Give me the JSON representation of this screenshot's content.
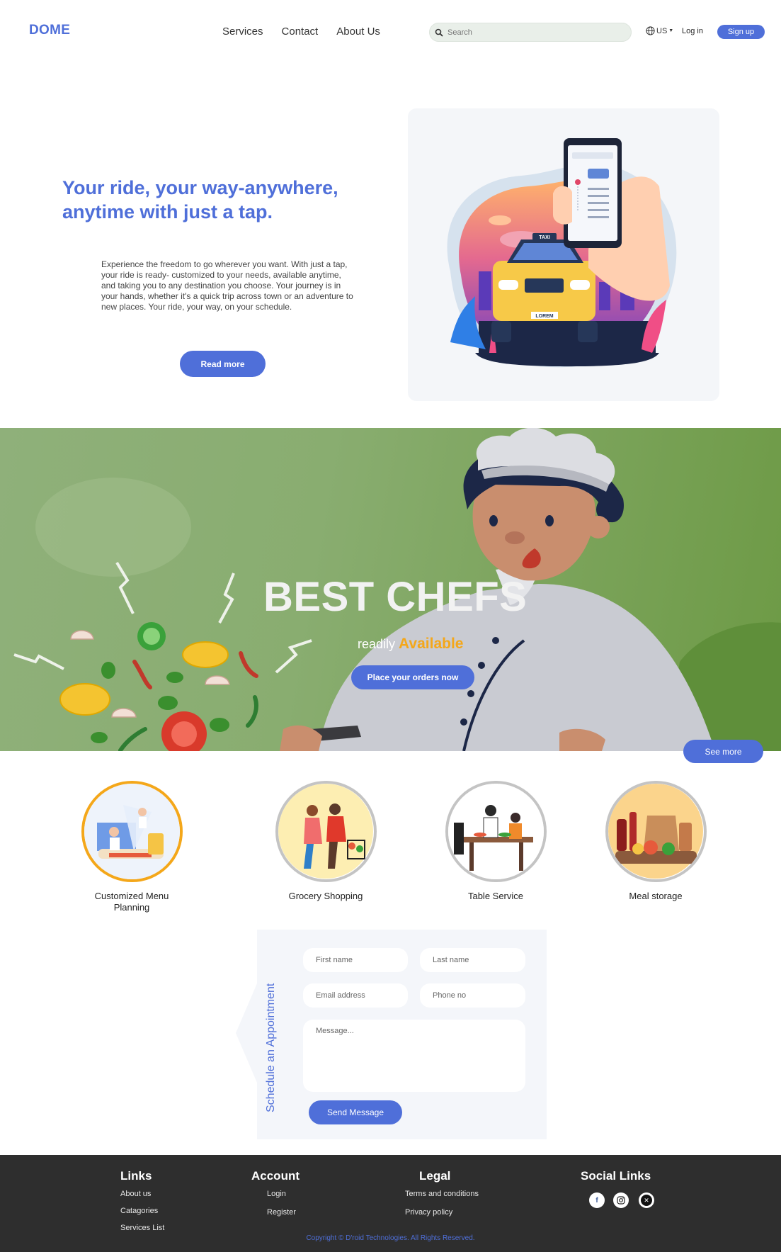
{
  "nav": {
    "logo": "DOME",
    "links": [
      "Services",
      "Contact",
      "About Us"
    ],
    "search_placeholder": "Search",
    "lang": "US",
    "login": "Log in",
    "signup": "Sign up"
  },
  "hero": {
    "title": "Your ride, your way-anywhere, anytime with just a tap.",
    "text": "Experience the freedom to go wherever you want. With just a tap, your ride is ready- customized to your needs, available anytime, and taking you to any destination you choose. Your journey is in your hands, whether it's a quick trip across town or an adventure to new places. Your ride, your way, on your schedule.",
    "button": "Read more",
    "illustration": {
      "taxi_sign": "TAXI",
      "plate": "LOREM"
    }
  },
  "banner": {
    "title": "BEST CHEFS",
    "sub_prefix": "readily",
    "sub_accent": "Available",
    "button": "Place your orders now",
    "see_more": "See more",
    "accent_color": "#f4a71a"
  },
  "services": [
    {
      "label": "Customized Menu Planning"
    },
    {
      "label": "Grocery Shopping"
    },
    {
      "label": "Table Service"
    },
    {
      "label": "Meal storage"
    }
  ],
  "appointment": {
    "title": "Schedule an Appointment",
    "first_name": "First name",
    "last_name": "Last name",
    "email": "Email address",
    "phone": "Phone no",
    "message": "Message...",
    "button": "Send Message"
  },
  "footer": {
    "links_title": "Links",
    "links": [
      "About us",
      "Catagories",
      "Services List"
    ],
    "account_title": "Account",
    "account": [
      "Login",
      "Register"
    ],
    "legal_title": "Legal",
    "legal": [
      "Terms and conditions",
      "Privacy policy"
    ],
    "social_title": "Social Links",
    "social_icons": [
      "facebook-icon",
      "instagram-icon",
      "x-icon"
    ],
    "copyright": "Copyright © D'roid Technologies. All Rights Reserved."
  },
  "colors": {
    "brand": "#4f6fd9",
    "footer_bg": "#2e2e2e",
    "banner_green": "#7ea65e"
  }
}
